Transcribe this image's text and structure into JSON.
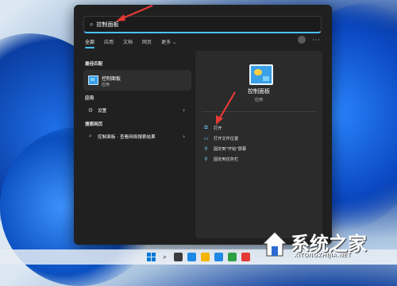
{
  "search": {
    "value": "控制面板",
    "placeholder": ""
  },
  "tabs": [
    {
      "label": "全部"
    },
    {
      "label": "应用"
    },
    {
      "label": "文档"
    },
    {
      "label": "网页"
    },
    {
      "label": "更多"
    }
  ],
  "sections": {
    "best_match": "最佳匹配",
    "apps": "应用",
    "web": "搜索网页"
  },
  "best_match": {
    "name": "控制面板",
    "type": "应用"
  },
  "apps": [
    {
      "label": "设置"
    }
  ],
  "web": [
    {
      "label": "控制面板 - 查看网络搜索结果"
    }
  ],
  "detail": {
    "name": "控制面板",
    "type": "应用",
    "actions": [
      {
        "label": "打开"
      },
      {
        "label": "打开文件位置"
      },
      {
        "label": "固定到\"开始\"屏幕"
      },
      {
        "label": "固定到任务栏"
      }
    ]
  },
  "watermark": {
    "title": "系统之家",
    "subtitle": "XITONGZHIJIA.NET"
  },
  "colors": {
    "accent": "#4cc2ff",
    "arrow": "#e53935",
    "panel": "#202020"
  }
}
